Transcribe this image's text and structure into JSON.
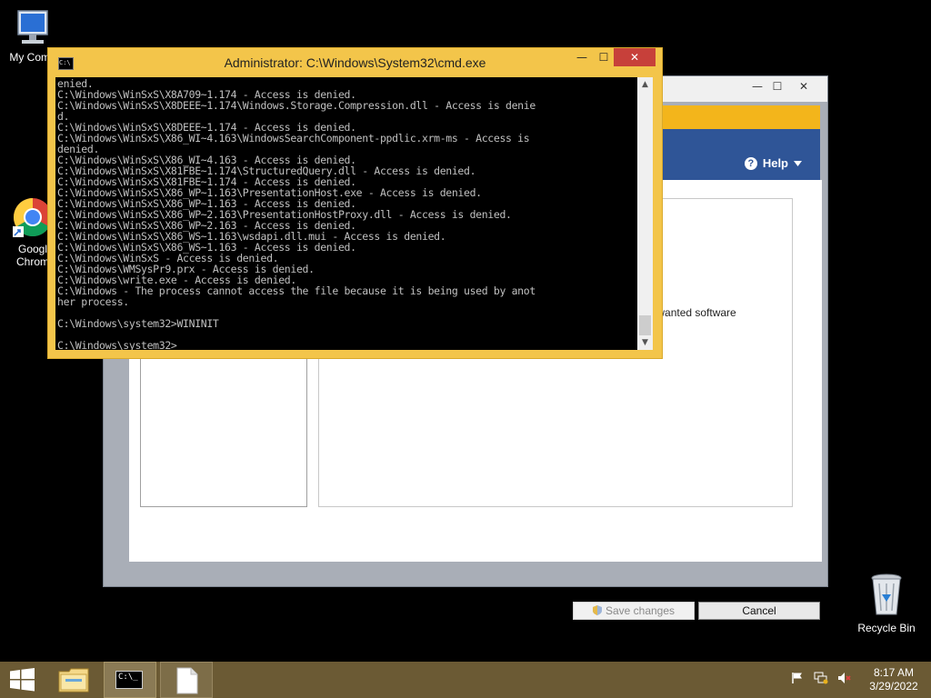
{
  "desktop": {
    "icons": [
      {
        "label": "My Comp"
      },
      {
        "label": "Googl"
      },
      {
        "label": "Chrom"
      },
      {
        "label": "Recycle Bin"
      }
    ]
  },
  "background_window": {
    "controls": {
      "minimize": "—",
      "maximize": "☐",
      "close": "✕"
    },
    "help_label": "Help",
    "help_icon": "?",
    "visible_text": "unwanted software",
    "save_label": "Save changes",
    "cancel_label": "Cancel"
  },
  "cmd_window": {
    "title": "Administrator: C:\\Windows\\System32\\cmd.exe",
    "icon_text": "C:\\",
    "controls": {
      "minimize": "—",
      "maximize": "☐",
      "close": "✕"
    },
    "lines": [
      "enied.",
      "C:\\Windows\\WinSxS\\X8A709~1.174 - Access is denied.",
      "C:\\Windows\\WinSxS\\X8DEEE~1.174\\Windows.Storage.Compression.dll - Access is denie",
      "d.",
      "C:\\Windows\\WinSxS\\X8DEEE~1.174 - Access is denied.",
      "C:\\Windows\\WinSxS\\X86_WI~4.163\\WindowsSearchComponent-ppdlic.xrm-ms - Access is",
      "denied.",
      "C:\\Windows\\WinSxS\\X86_WI~4.163 - Access is denied.",
      "C:\\Windows\\WinSxS\\X81FBE~1.174\\StructuredQuery.dll - Access is denied.",
      "C:\\Windows\\WinSxS\\X81FBE~1.174 - Access is denied.",
      "C:\\Windows\\WinSxS\\X86_WP~1.163\\PresentationHost.exe - Access is denied.",
      "C:\\Windows\\WinSxS\\X86_WP~1.163 - Access is denied.",
      "C:\\Windows\\WinSxS\\X86_WP~2.163\\PresentationHostProxy.dll - Access is denied.",
      "C:\\Windows\\WinSxS\\X86_WP~2.163 - Access is denied.",
      "C:\\Windows\\WinSxS\\X86_WS~1.163\\wsdapi.dll.mui - Access is denied.",
      "C:\\Windows\\WinSxS\\X86_WS~1.163 - Access is denied.",
      "C:\\Windows\\WinSxS - Access is denied.",
      "C:\\Windows\\WMSysPr9.prx - Access is denied.",
      "C:\\Windows\\write.exe - Access is denied.",
      "C:\\Windows - The process cannot access the file because it is being used by anot",
      "her process.",
      "",
      "C:\\Windows\\system32>WININIT",
      "",
      "C:\\Windows\\system32>"
    ]
  },
  "taskbar": {
    "cmd_icon_text": "C:\\_",
    "clock": {
      "time": "8:17 AM",
      "date": "3/29/2022"
    }
  },
  "colors": {
    "cmd_frame": "#f3c54a",
    "taskbar": "#6b5a34",
    "close_button": "#c7403a"
  }
}
